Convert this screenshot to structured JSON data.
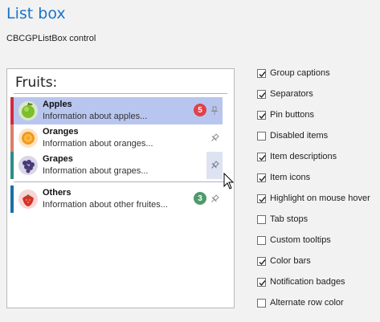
{
  "page": {
    "title": "List box",
    "subtitle": "CBCGPListBox control"
  },
  "listbox": {
    "group_caption": "Fruits:",
    "items": [
      {
        "name": "Apples",
        "desc": "Information about apples...",
        "badge": "5",
        "badge_color": "#e0414a",
        "bar_color": "#d42a3c",
        "icon": "apple-icon",
        "selected": true
      },
      {
        "name": "Oranges",
        "desc": "Information about oranges...",
        "badge": "",
        "bar_color": "#d9806a",
        "icon": "orange-icon",
        "selected": false
      },
      {
        "name": "Grapes",
        "desc": "Information about grapes...",
        "badge": "",
        "bar_color": "#2d8f86",
        "icon": "grapes-icon",
        "selected": false
      },
      {
        "name": "Others",
        "desc": "Information about other fruites...",
        "badge": "3",
        "badge_color": "#4f9a6c",
        "bar_color": "#1e6fa3",
        "icon": "strawberry-icon",
        "selected": false
      }
    ]
  },
  "options": [
    {
      "label": "Group captions",
      "checked": true
    },
    {
      "label": "Separators",
      "checked": true
    },
    {
      "label": "Pin buttons",
      "checked": true
    },
    {
      "label": "Disabled items",
      "checked": false
    },
    {
      "label": "Item descriptions",
      "checked": true
    },
    {
      "label": "Item icons",
      "checked": true
    },
    {
      "label": "Highlight on mouse hover",
      "checked": true
    },
    {
      "label": "Tab stops",
      "checked": false
    },
    {
      "label": "Custom tooltips",
      "checked": false
    },
    {
      "label": "Color bars",
      "checked": true
    },
    {
      "label": "Notification badges",
      "checked": true
    },
    {
      "label": "Alternate row color",
      "checked": false
    }
  ]
}
